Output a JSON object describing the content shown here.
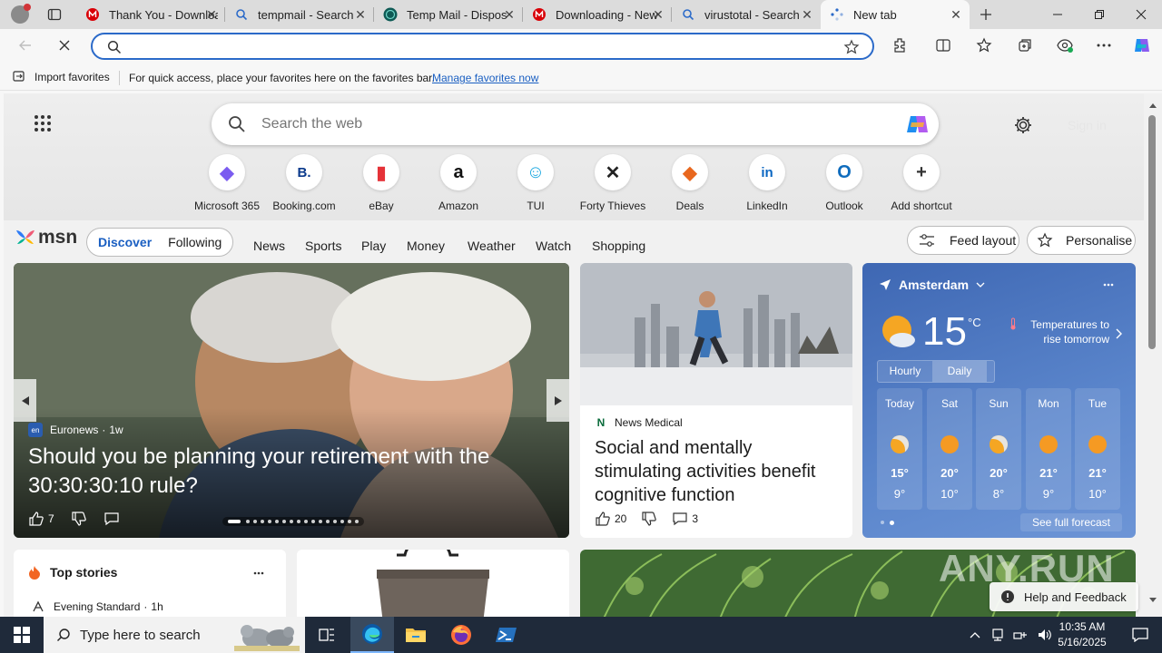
{
  "tabs": [
    {
      "title": "Thank You - Downloa",
      "icon": "mega-icon"
    },
    {
      "title": "tempmail - Search",
      "icon": "bing-search-icon"
    },
    {
      "title": "Temp Mail - Dispos",
      "icon": "tempmail-icon"
    },
    {
      "title": "Downloading - New",
      "icon": "mega-icon"
    },
    {
      "title": "virustotal - Search",
      "icon": "bing-search-icon"
    },
    {
      "title": "New tab",
      "icon": "edge-newtab-icon"
    }
  ],
  "favbar": {
    "import_label": "Import favorites",
    "hint": "For quick access, place your favorites here on the favorites bar.",
    "manage_link": "Manage favorites now"
  },
  "search": {
    "placeholder": "Search the web"
  },
  "signin": "Sign in",
  "shortcuts": [
    {
      "label": "Microsoft 365",
      "glyph": "◆",
      "color": "#7b5cf0"
    },
    {
      "label": "Booking.com",
      "glyph": "B.",
      "color": "#0b3a8c"
    },
    {
      "label": "eBay",
      "glyph": "▮",
      "color": "#e53238"
    },
    {
      "label": "Amazon",
      "glyph": "a",
      "color": "#111111"
    },
    {
      "label": "TUI",
      "glyph": "☺",
      "color": "#1aa7e0"
    },
    {
      "label": "Forty Thieves",
      "glyph": "✕",
      "color": "#222222"
    },
    {
      "label": "Deals",
      "glyph": "◆",
      "color": "#e8671e"
    },
    {
      "label": "LinkedIn",
      "glyph": "in",
      "color": "#0a66c2"
    },
    {
      "label": "Outlook",
      "glyph": "O",
      "color": "#0f6cbd"
    },
    {
      "label": "Add shortcut",
      "glyph": "+",
      "color": "#333333"
    }
  ],
  "msn": {
    "brand": "msn",
    "discover": "Discover",
    "following": "Following",
    "nav": [
      "News",
      "Sports",
      "Play",
      "Money",
      "Weather",
      "Watch",
      "Shopping"
    ],
    "feed_layout": "Feed layout",
    "personalise": "Personalise"
  },
  "hero_story": {
    "source": "Euronews",
    "age": "1w",
    "headline": "Should you be planning your retirement with the 30:30:30:10 rule?",
    "likes": "7"
  },
  "story2": {
    "source": "News Medical",
    "headline": "Social and mentally stimulating activities benefit cognitive function",
    "likes": "20",
    "comments": "3"
  },
  "weather": {
    "city": "Amsterdam",
    "temp": "15",
    "unit": "°C",
    "note": "Temperatures to rise tomorrow",
    "tab_hourly": "Hourly",
    "tab_daily": "Daily",
    "days": [
      {
        "name": "Today",
        "hi": "15°",
        "lo": "9°"
      },
      {
        "name": "Sat",
        "hi": "20°",
        "lo": "10°"
      },
      {
        "name": "Sun",
        "hi": "20°",
        "lo": "8°"
      },
      {
        "name": "Mon",
        "hi": "21°",
        "lo": "9°"
      },
      {
        "name": "Tue",
        "hi": "21°",
        "lo": "10°"
      }
    ],
    "see_full": "See full forecast"
  },
  "top_stories": {
    "title": "Top stories",
    "source": "Evening Standard",
    "age": "1h"
  },
  "help_feedback": "Help and Feedback",
  "watermark": "ANY.RUN",
  "taskbar": {
    "search_placeholder": "Type here to search",
    "time": "10:35 AM",
    "date": "5/16/2025"
  }
}
